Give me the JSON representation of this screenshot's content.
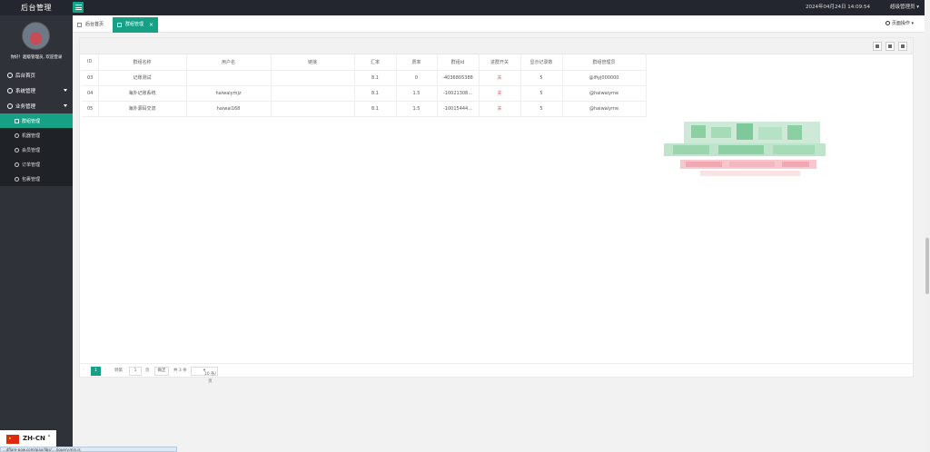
{
  "header": {
    "brand": "后台管理",
    "clock": "2024年04月24日 14:09:54",
    "user": "超级管理员"
  },
  "sidebar": {
    "welcome": "你好！超级管理员, 欢迎登录",
    "items": [
      {
        "label": "后台首页",
        "icon": "home-icon"
      },
      {
        "label": "系统管理",
        "icon": "gear-icon"
      },
      {
        "label": "业务管理",
        "icon": "gear-icon"
      }
    ],
    "subitems": [
      {
        "label": "群组管理",
        "icon": "edit-icon",
        "active": true
      },
      {
        "label": "机器管理",
        "icon": "circle-icon"
      },
      {
        "label": "会员管理",
        "icon": "check-circle-icon"
      },
      {
        "label": "订单管理",
        "icon": "share-icon"
      },
      {
        "label": "包裹管理",
        "icon": "gear-icon"
      }
    ]
  },
  "tabs": {
    "home": "后台首页",
    "current": "群组管理",
    "close": "×",
    "page_ops": "页面操作"
  },
  "table": {
    "headers": [
      "ID",
      "群组名称",
      "用户名",
      "链接",
      "汇率",
      "费率",
      "群组id",
      "进群开关",
      "显示记录数",
      "群组管理员"
    ],
    "rows": [
      [
        "03",
        "记账测试",
        "",
        "",
        "8.1",
        "0",
        "-4036805388",
        "关",
        "5",
        "@ifiyj000000"
      ],
      [
        "04",
        "海外记账系统",
        "haiwaiymjz",
        "",
        "8.1",
        "1.5",
        "-10021308...",
        "关",
        "5",
        "@haiwaiyme"
      ],
      [
        "05",
        "海外源码交流",
        "haiwai168",
        "",
        "8.1",
        "1.5",
        "-10015444...",
        "关",
        "5",
        "@haiwaiyme"
      ]
    ]
  },
  "pager": {
    "current": "1",
    "goto": "到第",
    "page_input": "1",
    "page_unit": "页",
    "confirm": "确定",
    "total": "共 3 条",
    "per_page": "10 条/页"
  },
  "lang": {
    "label": "ZH-CN"
  },
  "status_url": "...dflare-pow.com/ajax/libs/..../jquery.min.js"
}
